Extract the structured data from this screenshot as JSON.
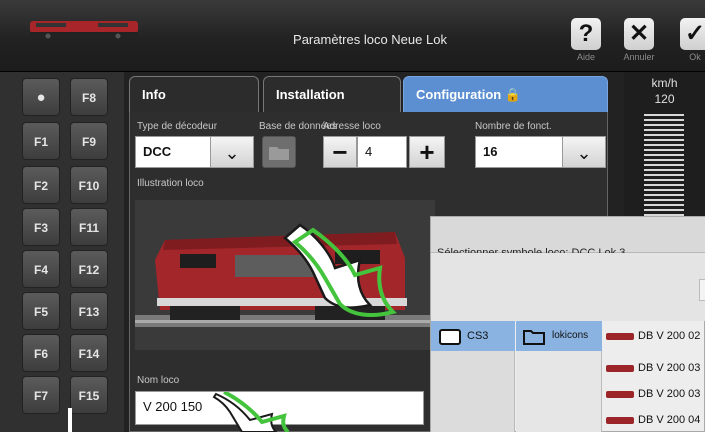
{
  "header": {
    "title": "Paramètres loco Neue Lok",
    "help_label": "Aide",
    "cancel_label": "Annuler",
    "ok_label": "Ok"
  },
  "functions": {
    "light": "",
    "left": [
      "F1",
      "F2",
      "F3",
      "F4",
      "F5",
      "F6",
      "F7"
    ],
    "right": [
      "F8",
      "F9",
      "F10",
      "F11",
      "F12",
      "F13",
      "F14",
      "F15"
    ]
  },
  "tabs": [
    "Info",
    "Installation",
    "Configuration"
  ],
  "config": {
    "decoder_type_label": "Type de décodeur",
    "decoder_type_value": "DCC",
    "database_label": "Base de données",
    "address_label": "Adresse loco",
    "address_value": "4",
    "functions_count_label": "Nombre de fonct.",
    "functions_count_value": "16",
    "illustration_label": "Illustration loco",
    "name_label": "Nom loco",
    "name_value": "V 200 150"
  },
  "speed": {
    "unit": "km/h",
    "value": "120"
  },
  "symbol_dialog": {
    "title": "Sélectionner symbole loco: DCC Lok 3",
    "source": "CS3",
    "folder": "lokicons",
    "locos": [
      "DB V 200 02",
      "DB V 200 03",
      "DB V 200 03",
      "DB V 200 04"
    ]
  },
  "colors": {
    "accent": "#5b8fd2",
    "selection": "#8ab3e2",
    "loco_red": "#9b2528"
  }
}
